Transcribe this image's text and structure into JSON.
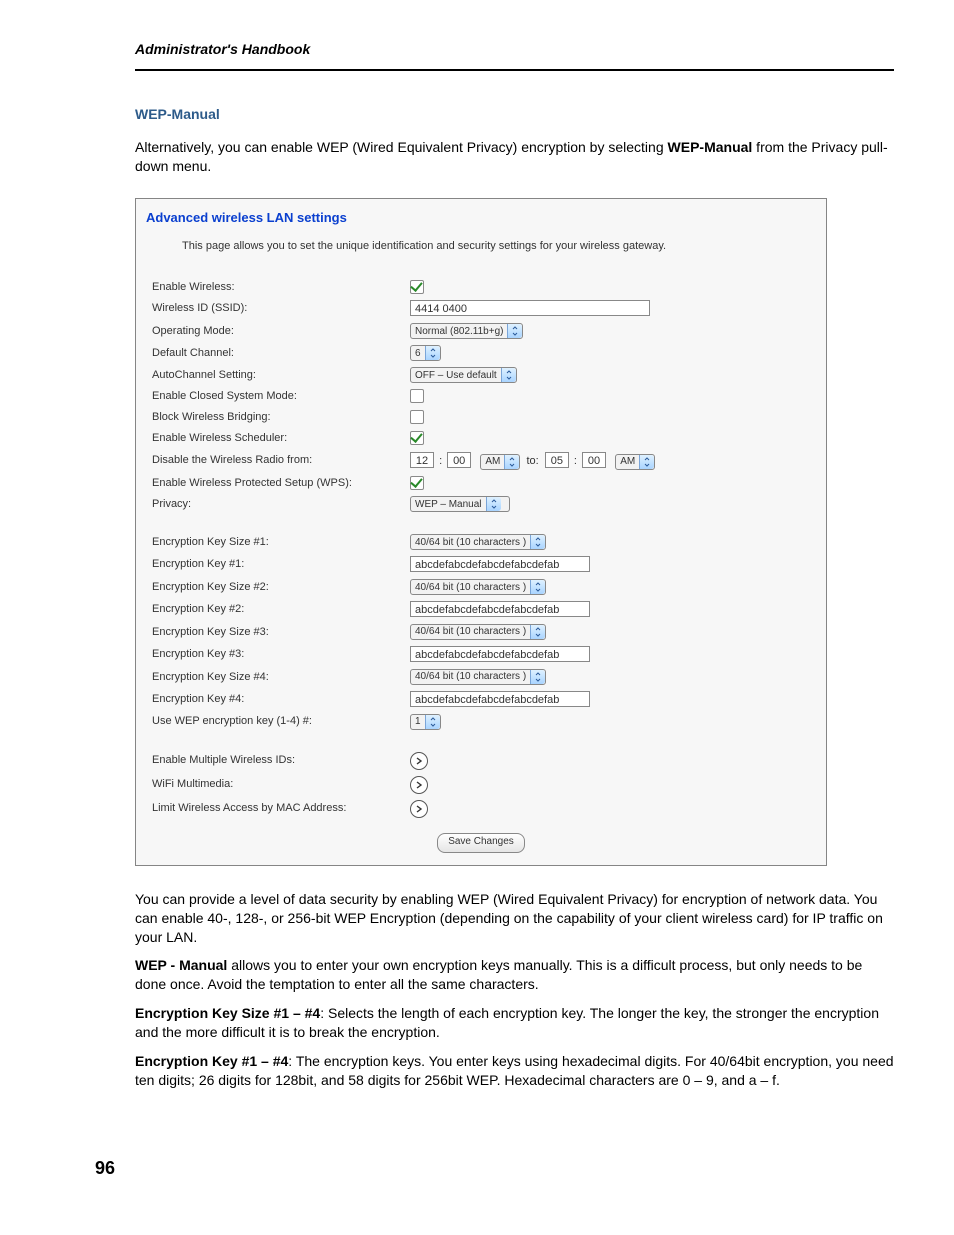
{
  "header": {
    "running_title": "Administrator's Handbook",
    "page_number": "96"
  },
  "section": {
    "heading": "WEP-Manual",
    "intro_pre": "Alternatively, you can enable WEP (Wired Equivalent Privacy) encryption by selecting ",
    "intro_bold": "WEP-Manual",
    "intro_post": " from the Privacy pull-down menu."
  },
  "embed": {
    "title": "Advanced wireless LAN settings",
    "desc": "This page allows you to set the unique identification and security settings for your wireless gateway.",
    "labels": {
      "enable_wireless": "Enable Wireless:",
      "ssid": "Wireless ID (SSID):",
      "op_mode": "Operating Mode:",
      "def_channel": "Default Channel:",
      "autochannel": "AutoChannel Setting:",
      "closed_mode": "Enable Closed System Mode:",
      "block_bridge": "Block Wireless Bridging:",
      "sched": "Enable Wireless Scheduler:",
      "disable_from": "Disable the Wireless Radio from:",
      "wps": "Enable Wireless Protected Setup (WPS):",
      "privacy": "Privacy:",
      "ek_size1": "Encryption Key Size #1:",
      "ek1": "Encryption Key #1:",
      "ek_size2": "Encryption Key Size #2:",
      "ek2": "Encryption Key #2:",
      "ek_size3": "Encryption Key Size #3:",
      "ek3": "Encryption Key #3:",
      "ek_size4": "Encryption Key Size #4:",
      "ek4": "Encryption Key #4:",
      "use_key": "Use WEP encryption key (1-4) #:",
      "multi_ids": "Enable Multiple Wireless IDs:",
      "wifi_mm": "WiFi Multimedia:",
      "limit_mac": "Limit Wireless Access by MAC Address:"
    },
    "values": {
      "ssid": "4414 0400",
      "op_mode": "Normal (802.11b+g)",
      "def_channel": "6",
      "autochannel": "OFF – Use default",
      "from_h": "12",
      "from_m": "00",
      "from_ampm": "AM",
      "to_label": "to:",
      "to_h": "05",
      "to_m": "00",
      "to_ampm": "AM",
      "privacy": "WEP – Manual",
      "ek_size_opt": "40/64 bit (10 characters )",
      "ek_val": "abcdefabcdefabcdefabcdefab",
      "use_key": "1",
      "save": "Save Changes"
    }
  },
  "after": {
    "p1": "You can provide a level of data security by enabling WEP (Wired Equivalent Privacy) for encryption of network data. You can enable 40-, 128-, or 256-bit WEP Encryption (depending on the capability of your client wireless card) for IP traffic on your LAN.",
    "p2_bold": "WEP - Manual",
    "p2_rest": " allows you to enter your own encryption keys manually. This is a difficult process, but only needs to be done once. Avoid the temptation to enter all the same characters.",
    "p3_bold": "Encryption Key Size #1 – #4",
    "p3_rest": ": Selects the length of each encryption key. The longer the key, the stronger the encryption and the more difficult it is to break the encryption.",
    "p4_bold": "Encryption Key #1 – #4",
    "p4_rest": ": The encryption keys. You enter keys using hexadecimal digits. For 40/64bit encryption, you need ten digits; 26 digits for 128bit, and 58 digits for 256bit WEP. Hexadecimal characters are 0 – 9, and a – f."
  }
}
